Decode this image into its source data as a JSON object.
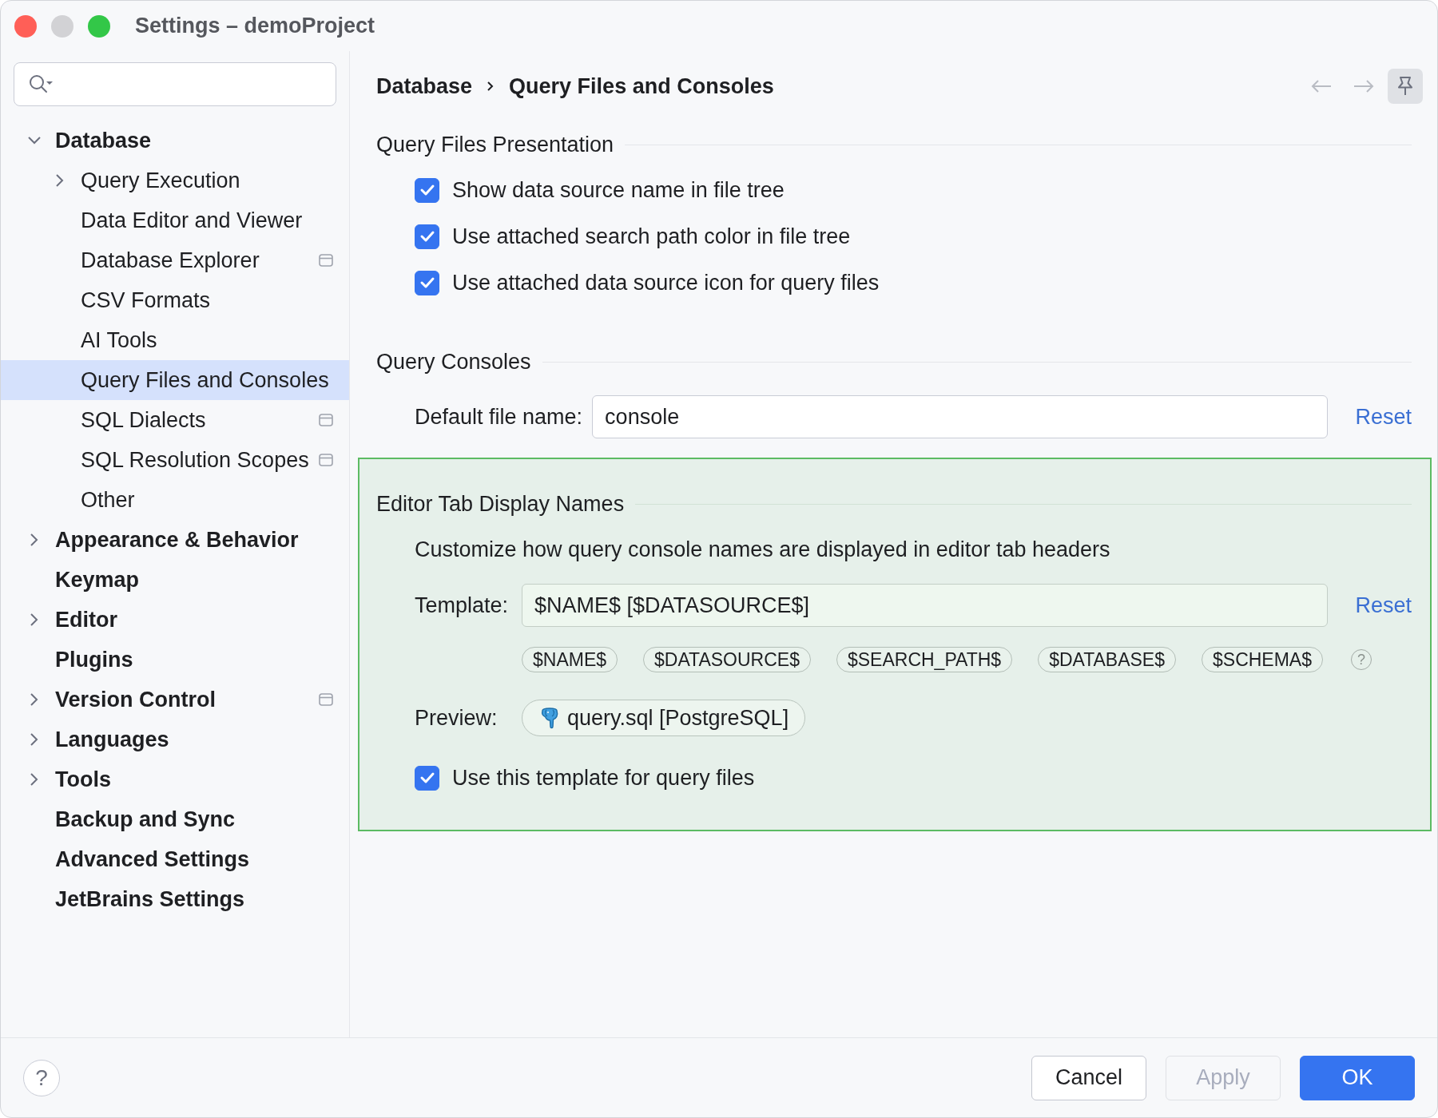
{
  "window": {
    "title": "Settings – demoProject",
    "controls": [
      {
        "kind": "close",
        "disabled": false
      },
      {
        "kind": "minimize",
        "disabled": true
      },
      {
        "kind": "zoom",
        "disabled": false
      }
    ]
  },
  "sidebar": {
    "items": [
      {
        "label": "Database",
        "expandable": true,
        "expanded": true,
        "selected": false,
        "indicator": false,
        "children": [
          {
            "label": "Query Execution",
            "expandable": true,
            "expanded": false,
            "selected": false,
            "indicator": false
          },
          {
            "label": "Data Editor and Viewer",
            "expandable": false,
            "expanded": false,
            "selected": false,
            "indicator": false
          },
          {
            "label": "Database Explorer",
            "expandable": false,
            "expanded": false,
            "selected": false,
            "indicator": true
          },
          {
            "label": "CSV Formats",
            "expandable": false,
            "expanded": false,
            "selected": false,
            "indicator": false
          },
          {
            "label": "AI Tools",
            "expandable": false,
            "expanded": false,
            "selected": false,
            "indicator": false
          },
          {
            "label": "Query Files and Consoles",
            "expandable": false,
            "expanded": false,
            "selected": true,
            "indicator": false
          },
          {
            "label": "SQL Dialects",
            "expandable": false,
            "expanded": false,
            "selected": false,
            "indicator": true
          },
          {
            "label": "SQL Resolution Scopes",
            "expandable": false,
            "expanded": false,
            "selected": false,
            "indicator": true
          },
          {
            "label": "Other",
            "expandable": false,
            "expanded": false,
            "selected": false,
            "indicator": false
          }
        ]
      },
      {
        "label": "Appearance & Behavior",
        "expandable": true,
        "expanded": false,
        "selected": false,
        "indicator": false
      },
      {
        "label": "Keymap",
        "expandable": false,
        "expanded": false,
        "selected": false,
        "indicator": false
      },
      {
        "label": "Editor",
        "expandable": true,
        "expanded": false,
        "selected": false,
        "indicator": false
      },
      {
        "label": "Plugins",
        "expandable": false,
        "expanded": false,
        "selected": false,
        "indicator": false
      },
      {
        "label": "Version Control",
        "expandable": true,
        "expanded": false,
        "selected": false,
        "indicator": true
      },
      {
        "label": "Languages",
        "expandable": true,
        "expanded": false,
        "selected": false,
        "indicator": false
      },
      {
        "label": "Tools",
        "expandable": true,
        "expanded": false,
        "selected": false,
        "indicator": false
      },
      {
        "label": "Backup and Sync",
        "expandable": false,
        "expanded": false,
        "selected": false,
        "indicator": false
      },
      {
        "label": "Advanced Settings",
        "expandable": false,
        "expanded": false,
        "selected": false,
        "indicator": false
      },
      {
        "label": "JetBrains Settings",
        "expandable": false,
        "expanded": false,
        "selected": false,
        "indicator": false
      }
    ]
  },
  "header": {
    "breadcrumb": [
      "Database",
      "Query Files and Consoles"
    ],
    "navigation": [
      {
        "kind": "back",
        "disabled": true
      },
      {
        "kind": "forward",
        "disabled": true
      }
    ],
    "pin": {
      "on": true
    }
  },
  "sections": [
    {
      "title": "Query Files Presentation",
      "highlighted": false,
      "items": [
        {
          "kind": "checkbox",
          "label": "Show data source name in file tree",
          "checked": true
        },
        {
          "kind": "checkbox",
          "label": "Use attached search path color in file tree",
          "checked": true
        },
        {
          "kind": "checkbox",
          "label": "Use attached data source icon for query files",
          "checked": true
        }
      ]
    },
    {
      "title": "Query Consoles",
      "highlighted": false,
      "items": [
        {
          "kind": "text_field",
          "label": "Default file name:",
          "value": "console",
          "reset": "Reset"
        }
      ]
    },
    {
      "title": "Editor Tab Display Names",
      "highlighted": true,
      "items": [
        {
          "kind": "description",
          "text": "Customize how query console names are displayed in editor tab headers"
        },
        {
          "kind": "text_field",
          "label": "Template:",
          "value": "$NAME$ [$DATASOURCE$]",
          "reset": "Reset"
        },
        {
          "kind": "chips",
          "chips": [
            "$NAME$",
            "$DATASOURCE$",
            "$SEARCH_PATH$",
            "$DATABASE$",
            "$SCHEMA$"
          ],
          "help": "?"
        },
        {
          "kind": "preview",
          "label": "Preview:",
          "value": "query.sql [PostgreSQL]"
        },
        {
          "kind": "checkbox",
          "label": "Use this template for query files",
          "checked": true
        }
      ]
    }
  ],
  "footer": {
    "help": "?",
    "buttons": [
      {
        "kind": "cancel",
        "label": "Cancel",
        "disabled": false
      },
      {
        "kind": "apply",
        "label": "Apply",
        "disabled": true
      },
      {
        "kind": "ok",
        "label": "OK",
        "disabled": false
      }
    ]
  }
}
